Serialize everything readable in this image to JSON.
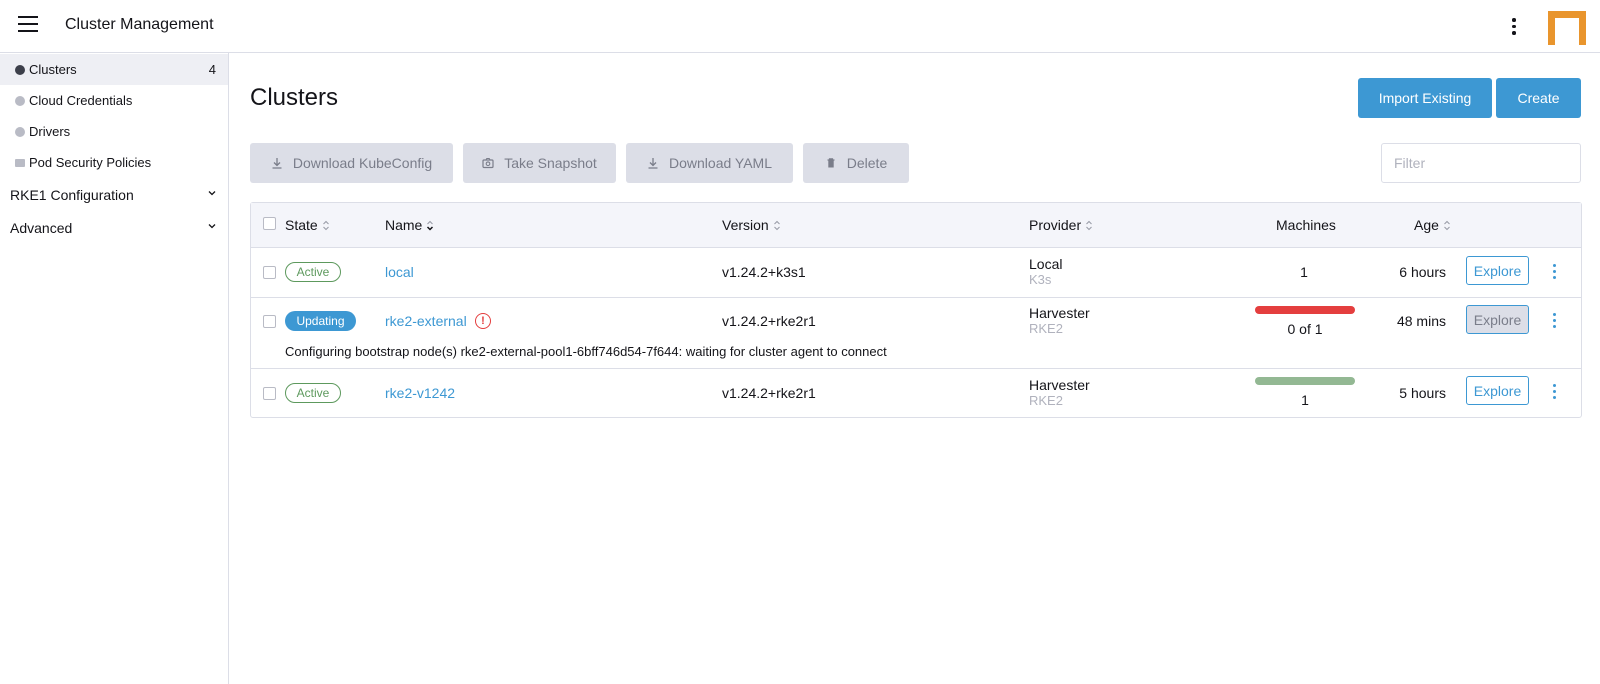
{
  "header": {
    "title": "Cluster Management",
    "menu_icon": "hamburger-icon",
    "more_icon": "kebab-vertical-icon",
    "logo": "rancher-logo"
  },
  "sidebar": {
    "items": [
      {
        "label": "Clusters",
        "count": "4",
        "icon": "globe-icon",
        "active": true
      },
      {
        "label": "Cloud Credentials",
        "icon": "globe-icon"
      },
      {
        "label": "Drivers",
        "icon": "globe-icon"
      },
      {
        "label": "Pod Security Policies",
        "icon": "folder-icon"
      }
    ],
    "groups": [
      {
        "label": "RKE1 Configuration"
      },
      {
        "label": "Advanced"
      }
    ]
  },
  "main": {
    "title": "Clusters",
    "import_label": "Import Existing",
    "create_label": "Create",
    "bulk": {
      "kubeconfig": "Download KubeConfig",
      "snapshot": "Take Snapshot",
      "yaml": "Download YAML",
      "delete": "Delete"
    },
    "filter_placeholder": "Filter"
  },
  "table": {
    "headers": {
      "state": "State",
      "name": "Name",
      "version": "Version",
      "provider": "Provider",
      "machines": "Machines",
      "age": "Age"
    },
    "rows": [
      {
        "state": "Active",
        "name": "local",
        "version": "v1.24.2+k3s1",
        "provider": "Local",
        "provider_sub": "K3s",
        "machines": "1",
        "age": "6 hours",
        "explore": "Explore"
      },
      {
        "state": "Updating",
        "name": "rke2-external",
        "version": "v1.24.2+rke2r1",
        "provider": "Harvester",
        "provider_sub": "RKE2",
        "machines": "0 of 1",
        "machines_ready_fraction": 0,
        "age": "48 mins",
        "explore": "Explore",
        "message": "Configuring bootstrap node(s) rke2-external-pool1-6bff746d54-7f644: waiting for cluster agent to connect",
        "error_icon": "!"
      },
      {
        "state": "Active",
        "name": "rke2-v1242",
        "version": "v1.24.2+rke2r1",
        "provider": "Harvester",
        "provider_sub": "RKE2",
        "machines": "1",
        "machines_ready_fraction": 1,
        "age": "5 hours",
        "explore": "Explore"
      }
    ]
  },
  "colors": {
    "accent": "#3d98d3",
    "active": "#5d995d",
    "error": "#e43e3e",
    "ready_bar": "#93b893",
    "logo": "#e9952d"
  }
}
